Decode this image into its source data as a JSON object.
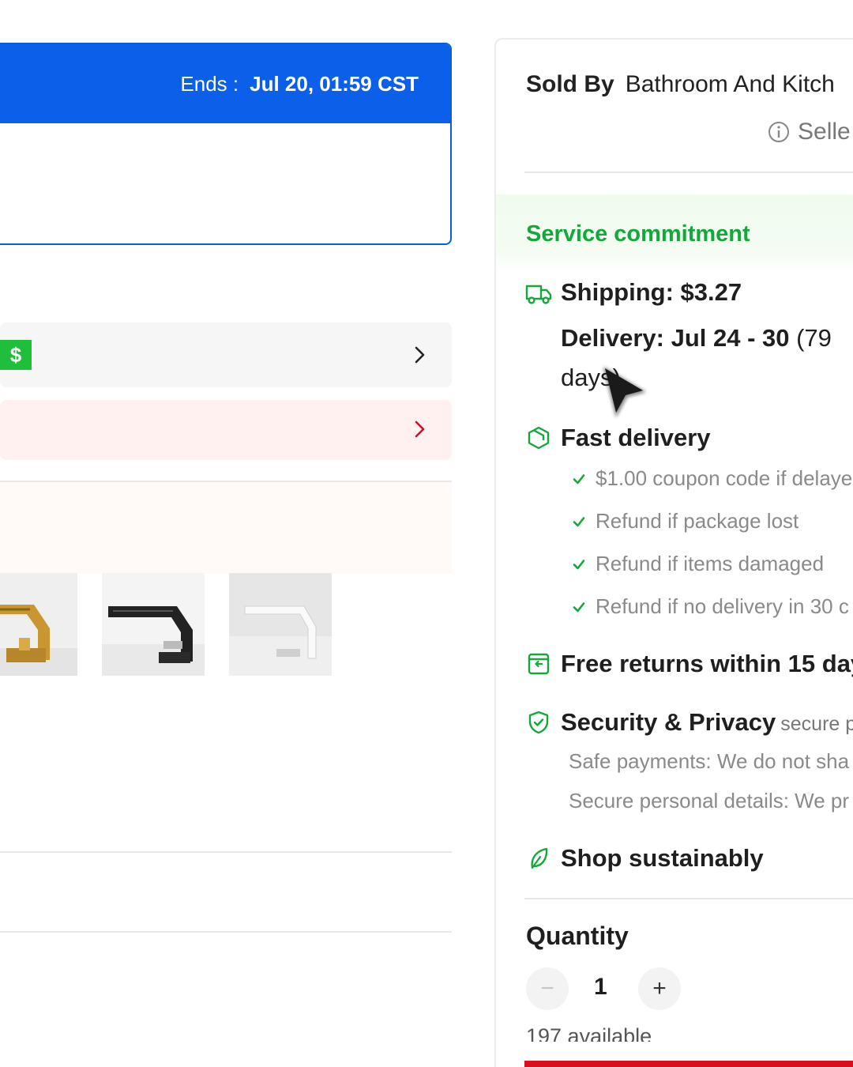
{
  "deal": {
    "ends_label": "Ends :",
    "ends_value": "Jul 20, 01:59 CST"
  },
  "promo": {
    "badge": "$"
  },
  "seller": {
    "sold_by_label": "Sold By",
    "name": "Bathroom And Kitch",
    "info_link": "Selle"
  },
  "service": {
    "title": "Service commitment",
    "shipping": "Shipping: $3.27",
    "delivery_bold": "Delivery: Jul 24 - 30",
    "delivery_rest": " (79",
    "delivery_line2": "days)",
    "fast_delivery": "Fast delivery",
    "checks": [
      "$1.00 coupon code if delaye",
      "Refund if package lost",
      "Refund if items damaged",
      "Refund if no delivery in 30 c"
    ],
    "free_returns": "Free returns within 15 day",
    "security_title": "Security & Privacy",
    "security_small": "secure p",
    "safe_payments": "Safe payments: We do not sha",
    "secure_details": "Secure personal details: We pr",
    "shop_sustainably": "Shop sustainably"
  },
  "quantity": {
    "label": "Quantity",
    "minus": "−",
    "value": "1",
    "plus": "+",
    "available": "197 available"
  },
  "colors": {
    "deal_blue": "#0b5fe8",
    "commit_green": "#14a83a",
    "badge_green": "#1fbf3c",
    "buy_red": "#d80f1e",
    "chevron_red": "#c8102e"
  },
  "thumbnails": [
    "gold-faucet",
    "black-faucet",
    "white-faucet"
  ]
}
